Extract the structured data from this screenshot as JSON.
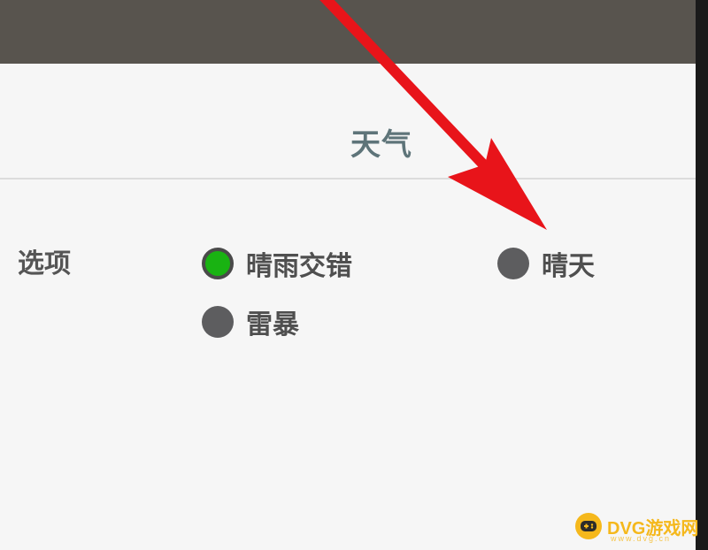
{
  "panel": {
    "title": "天气",
    "options_label": "选项",
    "options": [
      {
        "label": "晴雨交错",
        "selected": true
      },
      {
        "label": "晴天",
        "selected": false
      },
      {
        "label": "雷暴",
        "selected": false
      }
    ]
  },
  "colors": {
    "top_bar": "#58544e",
    "selected_radio": "#19b312",
    "unselected_radio": "#5d5d5f",
    "annotation_arrow": "#e8141a",
    "watermark": "#f5b81c"
  },
  "watermark": {
    "icon": "gamepad-icon",
    "text": "DVG游戏网",
    "subtext": "www.dvg.cn"
  }
}
